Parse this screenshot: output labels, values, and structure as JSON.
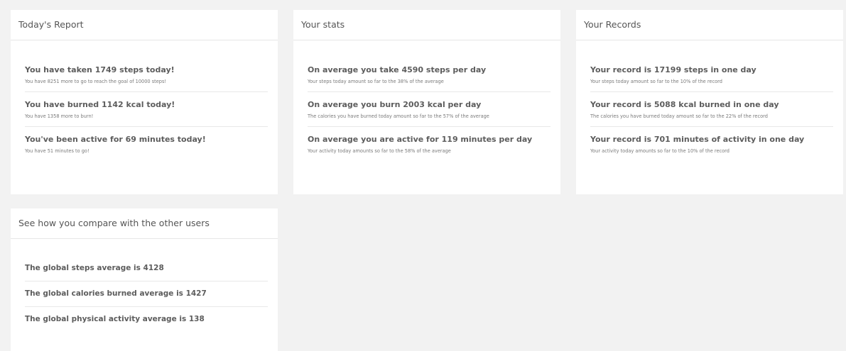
{
  "today_report": {
    "title": "Today's Report",
    "items": [
      {
        "title": "You have taken 1749 steps today!",
        "sub": "You have 8251 more to go to reach the goal of 10000 steps!"
      },
      {
        "title": "You have burned 1142 kcal today!",
        "sub": "You have 1358 more to burn!"
      },
      {
        "title": "You've been active for 69 minutes today!",
        "sub": "You have 51 minutes to go!"
      }
    ]
  },
  "stats": {
    "title": "Your stats",
    "items": [
      {
        "title": "On average you take 4590 steps per day",
        "sub": "Your steps today amount so far to the 38% of the average"
      },
      {
        "title": "On average you burn 2003 kcal per day",
        "sub": "The calories you have burned today amount so far to the 57% of the average"
      },
      {
        "title": "On average you are active for 119 minutes per day",
        "sub": "Your activity today amounts so far to the 58% of the average"
      }
    ]
  },
  "records": {
    "title": "Your Records",
    "items": [
      {
        "title": "Your record is 17199 steps in one day",
        "sub": "Your steps today amount so far to the 10% of the record"
      },
      {
        "title": "Your record is 5088 kcal burned in one day",
        "sub": "The calories you have burned today amount so far to the 22% of the record"
      },
      {
        "title": "Your record is 701 minutes of activity in one day",
        "sub": "Your activity today amounts so far to the 10% of the record"
      }
    ]
  },
  "compare": {
    "title": "See how you compare with the other users",
    "items": [
      {
        "title": "The global steps average is 4128"
      },
      {
        "title": "The global calories burned average is 1427"
      },
      {
        "title": "The global physical activity average is 138"
      }
    ]
  }
}
